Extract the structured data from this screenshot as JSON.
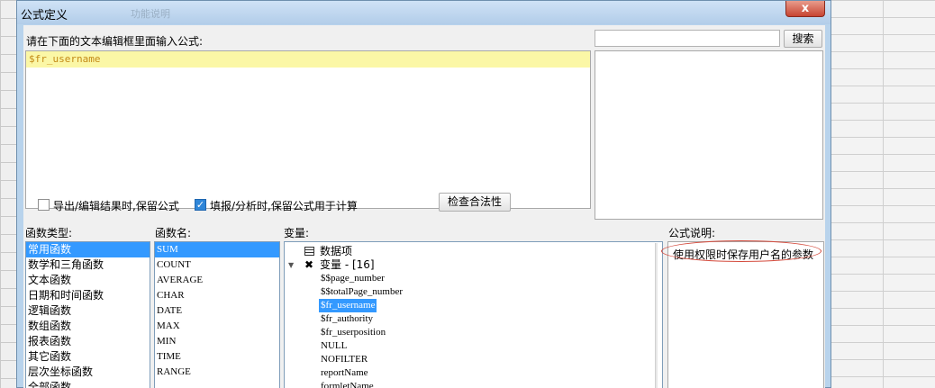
{
  "window": {
    "title": "公式定义",
    "ghost_title": "功能说明",
    "close_label": "x"
  },
  "editor": {
    "prompt": "请在下面的文本编辑框里面输入公式:",
    "formula": "$fr_username"
  },
  "search": {
    "placeholder": "",
    "button_label": "搜索"
  },
  "options": {
    "keep_formula_export": {
      "label": "导出/编辑结果时,保留公式",
      "checked": false
    },
    "keep_formula_fill": {
      "label": "填报/分析时,保留公式用于计算",
      "checked": true
    },
    "check_button_label": "检查合法性"
  },
  "function_types": {
    "header": "函数类型:",
    "items": [
      "常用函数",
      "数学和三角函数",
      "文本函数",
      "日期和时间函数",
      "逻辑函数",
      "数组函数",
      "报表函数",
      "其它函数",
      "层次坐标函数",
      "全部函数"
    ],
    "selected_index": 0
  },
  "function_names": {
    "header": "函数名:",
    "items": [
      "SUM",
      "COUNT",
      "AVERAGE",
      "CHAR",
      "DATE",
      "MAX",
      "MIN",
      "TIME",
      "RANGE"
    ],
    "selected_index": 0
  },
  "variables": {
    "header": "变量:",
    "data_items_label": "数据项",
    "group_label": "变量 - [16]",
    "items": [
      "$$page_number",
      "$$totalPage_number",
      "$fr_username",
      "$fr_authority",
      "$fr_userposition",
      "NULL",
      "NOFILTER",
      "reportName",
      "formletName"
    ],
    "selected_index": 2
  },
  "description": {
    "header": "公式说明:",
    "text": "使用权限时保存用户名的参数"
  },
  "icons": {
    "data_items": "table-icon",
    "variables_group": "variable-icon",
    "expand": "triangle-down-icon",
    "close": "close-icon",
    "checkbox_checked": "check-icon"
  },
  "colors": {
    "selection": "#3399ff",
    "editor_highlight": "#fbf7a6",
    "formula_text": "#c48a17",
    "annotation": "#d44a3c"
  }
}
